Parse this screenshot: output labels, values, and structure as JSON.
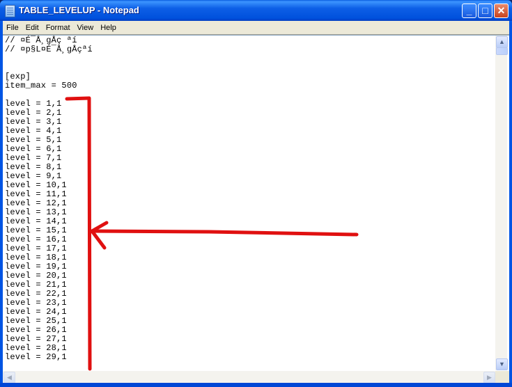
{
  "window": {
    "title": "TABLE_LEVELUP - Notepad",
    "icon": "notepad-icon",
    "controls": {
      "minimize": "_",
      "maximize": "□",
      "close": "✕"
    }
  },
  "menubar": {
    "items": [
      {
        "label": "File"
      },
      {
        "label": "Edit"
      },
      {
        "label": "Format"
      },
      {
        "label": "View"
      },
      {
        "label": "Help"
      }
    ]
  },
  "editor": {
    "lines": [
      "// ¤É¯Å¸gÅç ªí",
      "// ¤p§L¤É¯Å¸gÅçªí",
      "",
      "",
      "[exp]",
      "item_max = 500",
      "",
      "level = 1,1",
      "level = 2,1",
      "level = 3,1",
      "level = 4,1",
      "level = 5,1",
      "level = 6,1",
      "level = 7,1",
      "level = 8,1",
      "level = 9,1",
      "level = 10,1",
      "level = 11,1",
      "level = 12,1",
      "level = 13,1",
      "level = 14,1",
      "level = 15,1",
      "level = 16,1",
      "level = 17,1",
      "level = 18,1",
      "level = 19,1",
      "level = 20,1",
      "level = 21,1",
      "level = 22,1",
      "level = 23,1",
      "level = 24,1",
      "level = 25,1",
      "level = 26,1",
      "level = 27,1",
      "level = 28,1",
      "level = 29,1"
    ]
  },
  "scrollbars": {
    "up": "▲",
    "down": "▼",
    "left": "◀",
    "right": "▶"
  },
  "annotation": {
    "color": "#e01010",
    "description": "red bracket and arrow pointing at level lines"
  }
}
